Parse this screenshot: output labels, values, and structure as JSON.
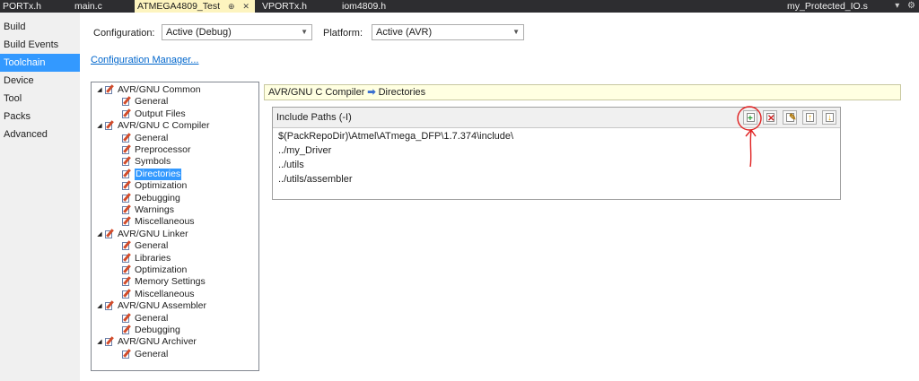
{
  "tabs": [
    {
      "label": "PORTx.h"
    },
    {
      "label": "main.c"
    },
    {
      "label": "ATMEGA4809_Test",
      "pin": "⊕",
      "close": "✕"
    },
    {
      "label": "VPORTx.h"
    },
    {
      "label": "iom4809.h"
    },
    {
      "label": "my_Protected_IO.s"
    }
  ],
  "tabbar_icons": {
    "dropdown": "▾",
    "settings": "⚙"
  },
  "nav": {
    "items": [
      "Build",
      "Build Events",
      "Toolchain",
      "Device",
      "Tool",
      "Packs",
      "Advanced"
    ],
    "active": "Toolchain"
  },
  "config": {
    "configuration_label": "Configuration:",
    "configuration_value": "Active (Debug)",
    "platform_label": "Platform:",
    "platform_value": "Active (AVR)",
    "manager_link": "Configuration Manager..."
  },
  "tree": {
    "groups": [
      {
        "label": "AVR/GNU Common",
        "children": [
          "General",
          "Output Files"
        ]
      },
      {
        "label": "AVR/GNU C Compiler",
        "children": [
          "General",
          "Preprocessor",
          "Symbols",
          "Directories",
          "Optimization",
          "Debugging",
          "Warnings",
          "Miscellaneous"
        ]
      },
      {
        "label": "AVR/GNU Linker",
        "children": [
          "General",
          "Libraries",
          "Optimization",
          "Memory Settings",
          "Miscellaneous"
        ]
      },
      {
        "label": "AVR/GNU Assembler",
        "children": [
          "General",
          "Debugging"
        ]
      },
      {
        "label": "AVR/GNU Archiver",
        "children": [
          "General"
        ]
      }
    ],
    "selected": "Directories",
    "expander": "◢"
  },
  "breadcrumb": {
    "parent": "AVR/GNU C Compiler",
    "separator": "➡",
    "current": "Directories"
  },
  "include_paths": {
    "title": "Include Paths (-I)",
    "items": [
      "$(PackRepoDir)\\Atmel\\ATmega_DFP\\1.7.374\\include\\",
      "../my_Driver",
      "../utils",
      "../utils/assembler"
    ]
  },
  "toolbar_icons": [
    "add-item-icon",
    "delete-item-icon",
    "edit-item-icon",
    "move-up-icon",
    "move-down-icon"
  ],
  "colors": {
    "tab_active": "#fdf4bf",
    "nav_active": "#3399ff",
    "annotation": "#e02020"
  }
}
